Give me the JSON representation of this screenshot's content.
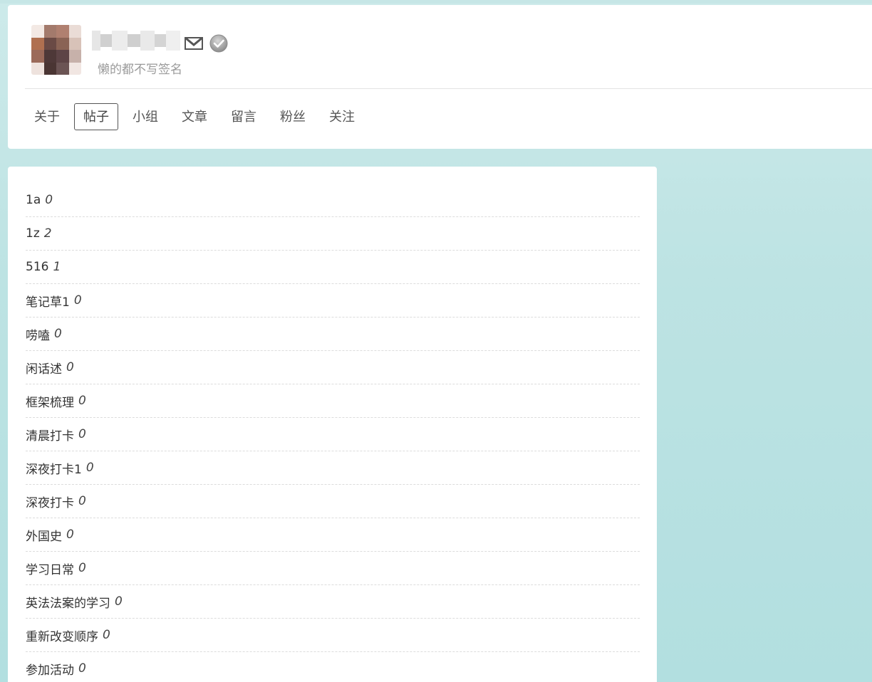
{
  "profile": {
    "signature": "懒的都不写签名",
    "avatar_colors": [
      "#f3e9e4",
      "#a37a6c",
      "#b08070",
      "#eadcd6",
      "#b07050",
      "#6a4a45",
      "#8a6355",
      "#d8c2b8",
      "#9b6a5a",
      "#4e3838",
      "#5d4446",
      "#c7b1aa",
      "#eee2dd",
      "#4a3533",
      "#6b5454",
      "#f1e6e2"
    ],
    "username_blur_colors": [
      "#e6e6e6",
      "#d0d0d0",
      "#ececec",
      "#cfcfcf",
      "#e9e9e9",
      "#d4d4d4",
      "#efefef"
    ]
  },
  "icons": {
    "mail": "mail-icon",
    "verified": "verified-check-icon"
  },
  "nav": {
    "tabs": [
      {
        "label": "关于",
        "active": false
      },
      {
        "label": "帖子",
        "active": true
      },
      {
        "label": "小组",
        "active": false
      },
      {
        "label": "文章",
        "active": false
      },
      {
        "label": "留言",
        "active": false
      },
      {
        "label": "粉丝",
        "active": false
      },
      {
        "label": "关注",
        "active": false
      }
    ]
  },
  "tags": [
    {
      "name": "1a",
      "count": "0"
    },
    {
      "name": "1z",
      "count": "2"
    },
    {
      "name": "516",
      "count": "1"
    },
    {
      "name": "笔记草1",
      "count": "0"
    },
    {
      "name": "唠嗑",
      "count": "0"
    },
    {
      "name": "闲话述",
      "count": "0"
    },
    {
      "name": "框架梳理",
      "count": "0"
    },
    {
      "name": "清晨打卡",
      "count": "0"
    },
    {
      "name": "深夜打卡1",
      "count": "0"
    },
    {
      "name": "深夜打卡",
      "count": "0"
    },
    {
      "name": "外国史",
      "count": "0"
    },
    {
      "name": "学习日常",
      "count": "0"
    },
    {
      "name": "英法法案的学习",
      "count": "0"
    },
    {
      "name": "重新改变顺序",
      "count": "0"
    },
    {
      "name": "参加活动",
      "count": "0"
    }
  ],
  "colors": {
    "background": "#b8e1e1",
    "card": "#ffffff",
    "active_tab_border": "#555555"
  }
}
